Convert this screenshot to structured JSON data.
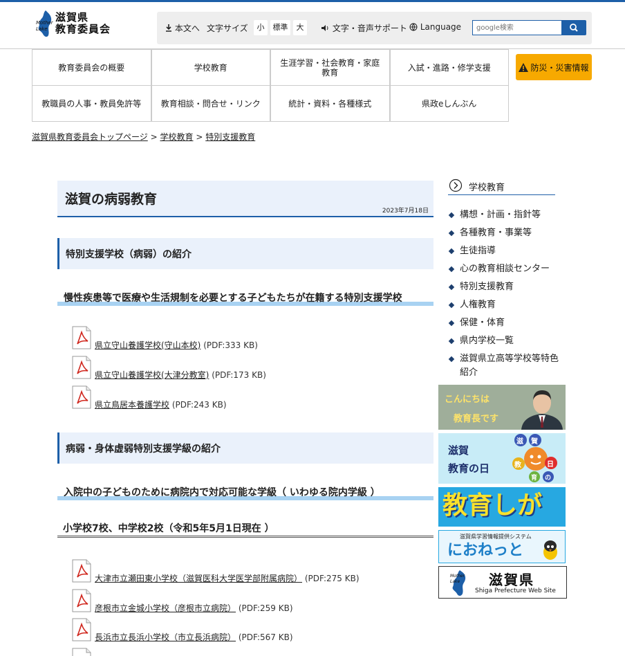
{
  "header": {
    "logo_text_line1": "滋賀県",
    "logo_text_line2": "教育委員会",
    "logo_mark_text": "Mother Lake",
    "skip_to_content": "本文へ",
    "font_size_label": "文字サイズ",
    "font_sizes": [
      "小",
      "標準",
      "大"
    ],
    "voice_support": "文字・音声サポート",
    "language": "Language",
    "search_placeholder": "google検索"
  },
  "nav": {
    "items": [
      "教育委員会の概要",
      "学校教育",
      "生涯学習・社会教育・家庭教育",
      "入試・進路・修学支援",
      "教職員の人事・教員免許等",
      "教育相談・問合せ・リンク",
      "統計・資料・各種様式",
      "県政eしんぶん"
    ],
    "disaster": "防災・災害情報"
  },
  "breadcrumb": [
    "滋賀県教育委員会トップページ",
    "学校教育",
    "特別支援教育"
  ],
  "breadcrumb_separator": ">",
  "main": {
    "title": "滋賀の病弱教育",
    "date": "2023年7月18日",
    "section1_heading": "特別支援学校（病弱）の紹介",
    "section1_sub": "慢性疾患等で医療や生活規制を必要とする子どもたちが在籍する特別支援学校",
    "section1_files": [
      {
        "name": "県立守山養護学校(守山本校)",
        "meta": "(PDF:333 KB)"
      },
      {
        "name": "県立守山養護学校(大津分教室)",
        "meta": "(PDF:173 KB)"
      },
      {
        "name": "県立鳥居本養護学校",
        "meta": "(PDF:243 KB)"
      }
    ],
    "section2_heading": "病弱・身体虚弱特別支援学級の紹介",
    "section2_sub": "入院中の子どものために病院内で対応可能な学級（ いわゆる院内学級 ）",
    "section2_count": "小学校7校、中学校2校（令和5年5月1日現在 ）",
    "section2_files": [
      {
        "name": "大津市立瀬田東小学校（滋賀医科大学医学部附属病院）",
        "meta": "(PDF:275 KB)"
      },
      {
        "name": "彦根市立金城小学校（彦根市立病院）",
        "meta": "(PDF:259 KB)"
      },
      {
        "name": "長浜市立長浜小学校（市立長浜病院）",
        "meta": "(PDF:567 KB)"
      }
    ]
  },
  "sidebar": {
    "title": "学校教育",
    "items": [
      "構想・計画・指針等",
      "各種教育・事業等",
      "生徒指導",
      "心の教育相談センター",
      "特別支援教育",
      "人権教育",
      "保健・体育",
      "県内学校一覧",
      "滋賀県立高等学校等特色紹介"
    ]
  },
  "banners": {
    "kyoikucho_line1": "こんにちは",
    "kyoikucho_line2": "教育長です",
    "kyoiku_no_hi_line1": "滋賀",
    "kyoiku_no_hi_line2": "教育の日",
    "kyoiku_no_hi_circles": [
      "滋",
      "賀",
      "教",
      "日",
      "育",
      "の"
    ],
    "kyoiku_shiga": "教育しが",
    "nionet_sub": "滋賀県学習情報提供システム",
    "nionet": "におねっと",
    "shiga_pref": "滋賀県",
    "shiga_pref_sub": "Shiga Prefecture Web Site"
  },
  "colors": {
    "accent": "#1d5fa8",
    "heading_bg": "#eaf1fb",
    "sub_underline": "#a8d2f2",
    "disaster": "#f7a900"
  }
}
